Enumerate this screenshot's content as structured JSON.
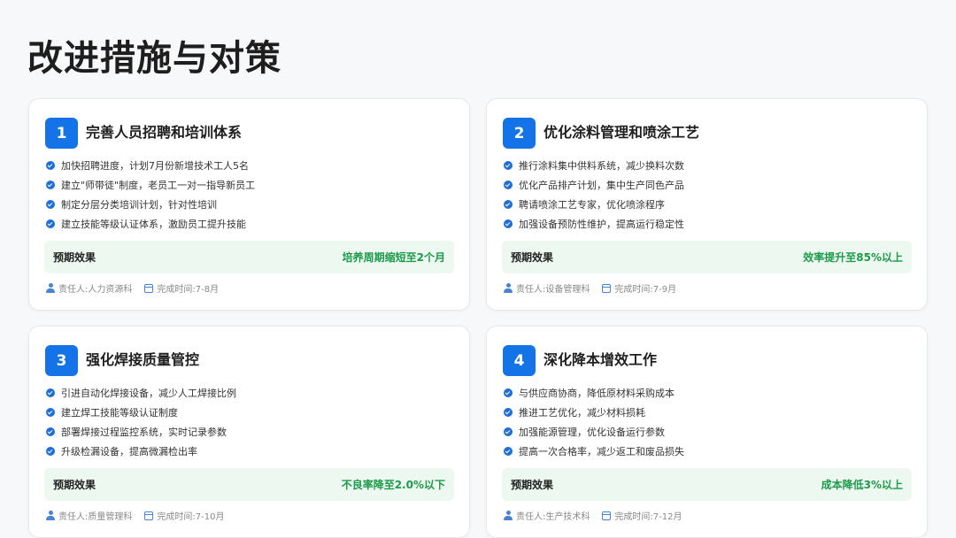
{
  "page": {
    "title": "改进措施与对策"
  },
  "labels": {
    "effect": "预期效果"
  },
  "cards": [
    {
      "number": "1",
      "title": "完善人员招聘和培训体系",
      "bullets": [
        "加快招聘进度，计划7月份新增技术工人5名",
        "建立\"师带徒\"制度，老员工一对一指导新员工",
        "制定分层分类培训计划，针对性培训",
        "建立技能等级认证体系，激励员工提升技能"
      ],
      "effect": "培养周期缩短至2个月",
      "owner": "责任人:人力资源科",
      "deadline": "完成时间:7-8月"
    },
    {
      "number": "2",
      "title": "优化涂料管理和喷涂工艺",
      "bullets": [
        "推行涂料集中供料系统，减少换料次数",
        "优化产品排产计划，集中生产同色产品",
        "聘请喷涂工艺专家，优化喷涂程序",
        "加强设备预防性维护，提高运行稳定性"
      ],
      "effect": "效率提升至85%以上",
      "owner": "责任人:设备管理科",
      "deadline": "完成时间:7-9月"
    },
    {
      "number": "3",
      "title": "强化焊接质量管控",
      "bullets": [
        "引进自动化焊接设备，减少人工焊接比例",
        "建立焊工技能等级认证制度",
        "部署焊接过程监控系统，实时记录参数",
        "升级检漏设备，提高微漏检出率"
      ],
      "effect": "不良率降至2.0%以下",
      "owner": "责任人:质量管理科",
      "deadline": "完成时间:7-10月"
    },
    {
      "number": "4",
      "title": "深化降本增效工作",
      "bullets": [
        "与供应商协商，降低原材料采购成本",
        "推进工艺优化，减少材料损耗",
        "加强能源管理，优化设备运行参数",
        "提高一次合格率，减少返工和废品损失"
      ],
      "effect": "成本降低3%以上",
      "owner": "责任人:生产技术科",
      "deadline": "完成时间:7-12月"
    }
  ],
  "colors": {
    "accent": "#1473e6",
    "effect_bg": "#edf8f0",
    "effect_text": "#1d9a4a"
  },
  "icons": {
    "bullet": "check-circle-icon",
    "owner": "person-icon",
    "deadline": "calendar-icon"
  }
}
